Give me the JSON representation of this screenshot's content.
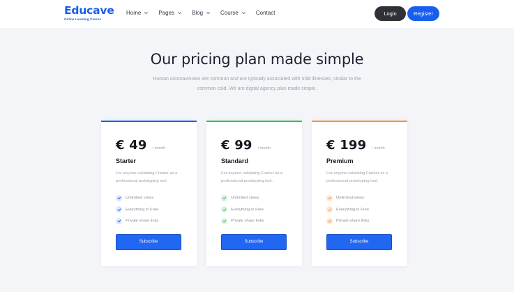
{
  "brand": {
    "name": "Educave",
    "tagline": "Online Learning Course"
  },
  "nav": {
    "items": [
      {
        "label": "Home",
        "dropdown": true
      },
      {
        "label": "Pages",
        "dropdown": true
      },
      {
        "label": "Blog",
        "dropdown": true
      },
      {
        "label": "Course",
        "dropdown": true
      },
      {
        "label": "Contact",
        "dropdown": false
      }
    ],
    "login_label": "Login",
    "register_label": "Register"
  },
  "hero": {
    "title": "Our pricing plan made simple",
    "subtitle": "Human coronaviruses are common and are typically associated with mild illnesses, similar to the common cold. We are digital agency plan made simple."
  },
  "plans": [
    {
      "price": "€ 49",
      "period": "/ month",
      "name": "Starter",
      "description": "For anyone validating Framer as a professional prototyping tool.",
      "features": [
        "Unlimited views",
        "Everything in Free",
        "Private share links"
      ],
      "cta": "Subscribe",
      "accent": "#1a5ef0",
      "check_bg": "#dbe6fd",
      "check_color": "#1a5ef0"
    },
    {
      "price": "€ 99",
      "period": "/ month",
      "name": "Standard",
      "description": "For anyone validating Framer as a professional prototyping tool.",
      "features": [
        "Unlimited views",
        "Everything in Free",
        "Private share links"
      ],
      "cta": "Subscribe",
      "accent": "#2fbf56",
      "check_bg": "#d8f3df",
      "check_color": "#2fbf56"
    },
    {
      "price": "€ 199",
      "period": "/ month",
      "name": "Premium",
      "description": "For anyone validating Framer as a professional prototyping tool.",
      "features": [
        "Unlimited views",
        "Everything in Free",
        "Private share links"
      ],
      "cta": "Subscribe",
      "accent": "#f5923e",
      "check_bg": "#fde6d2",
      "check_color": "#f5923e"
    }
  ],
  "icons": {
    "dropdown": "chevron-down-icon",
    "feature": "check-circle-icon"
  }
}
